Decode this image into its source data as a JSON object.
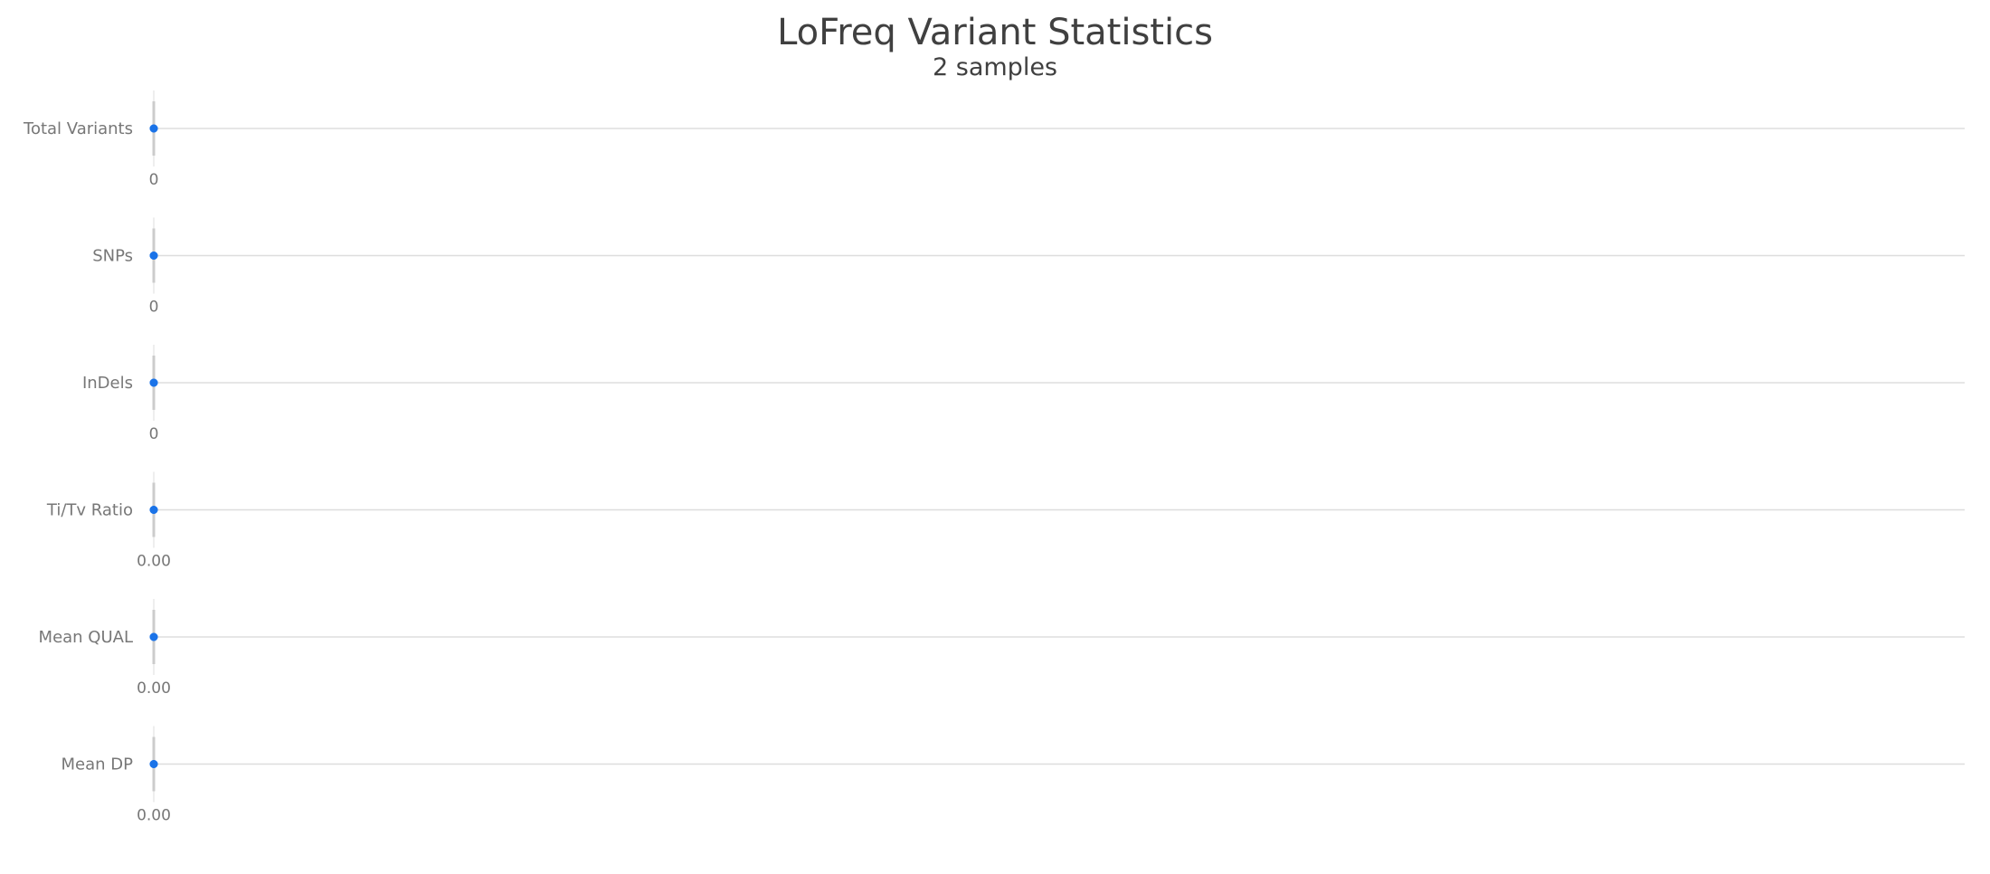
{
  "chart_data": {
    "type": "scatter",
    "title": "LoFreq Variant Statistics",
    "subtitle": "2 samples",
    "colors": {
      "point": "#1a73e8",
      "baseline": "#dddddd",
      "range_band": "#cccccc",
      "label": "#777777",
      "title": "#404040"
    },
    "grid": false,
    "rows": [
      {
        "label": "Total Variants",
        "values": [
          0,
          0
        ],
        "tick_label": "0"
      },
      {
        "label": "SNPs",
        "values": [
          0,
          0
        ],
        "tick_label": "0"
      },
      {
        "label": "InDels",
        "values": [
          0,
          0
        ],
        "tick_label": "0"
      },
      {
        "label": "Ti/Tv Ratio",
        "values": [
          0,
          0
        ],
        "tick_label": "0.00"
      },
      {
        "label": "Mean QUAL",
        "values": [
          0,
          0
        ],
        "tick_label": "0.00"
      },
      {
        "label": "Mean DP",
        "values": [
          0,
          0
        ],
        "tick_label": "0.00"
      }
    ]
  }
}
